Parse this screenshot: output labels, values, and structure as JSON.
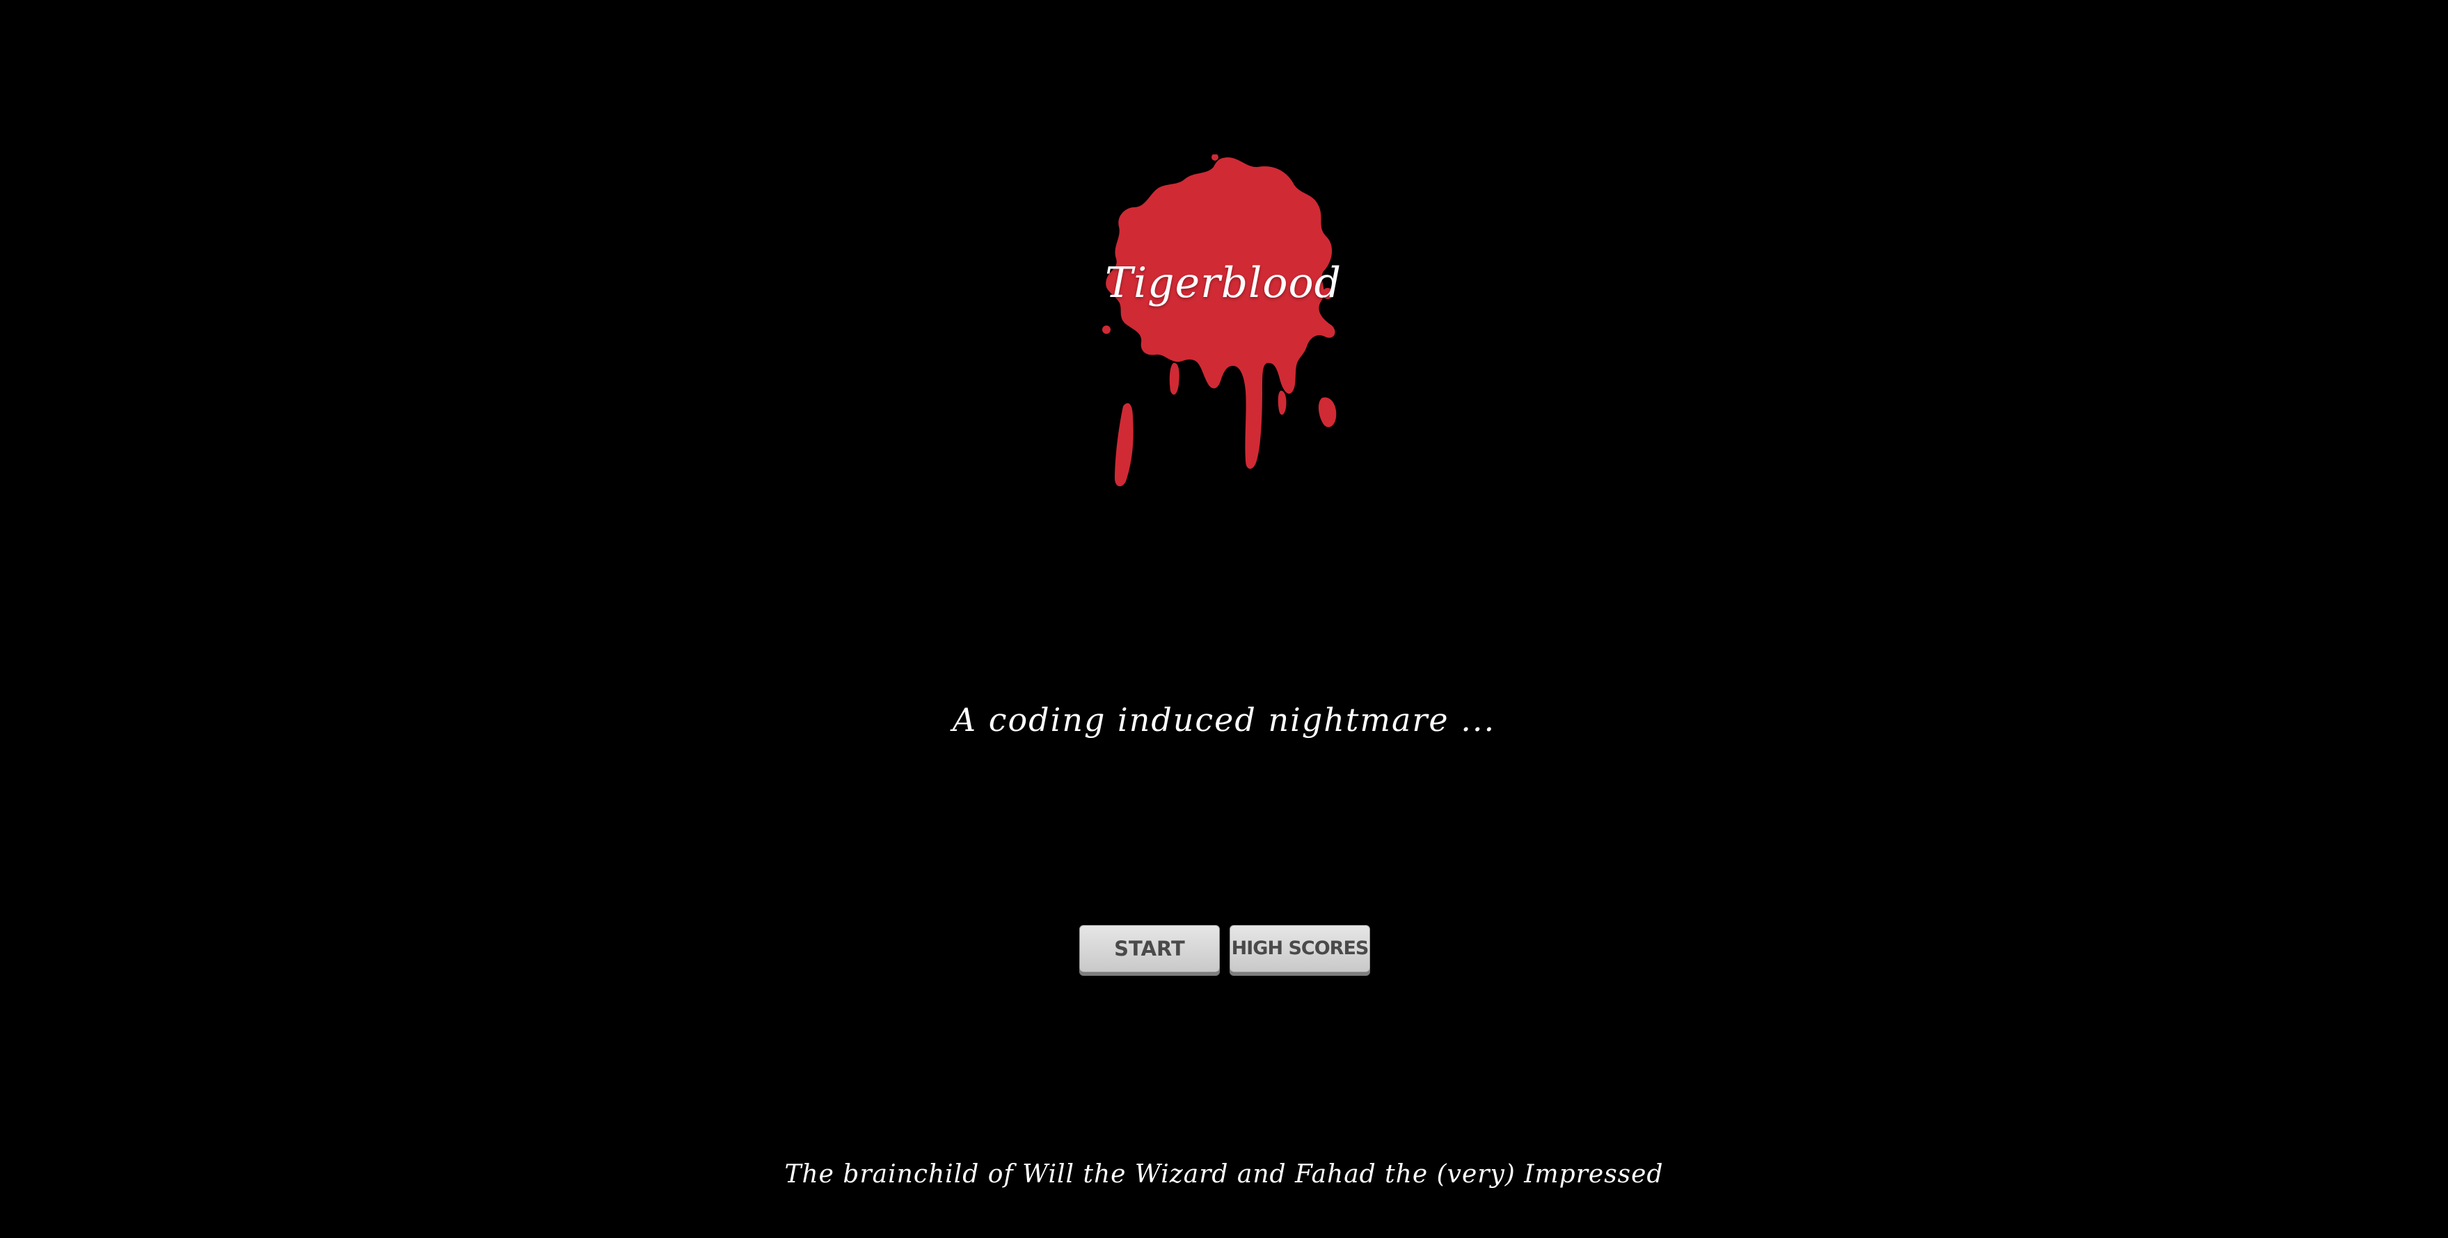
{
  "game": {
    "title": "Tigerblood",
    "tagline": "A coding induced nightmare ...",
    "credits": "The brainchild of Will the Wizard and Fahad the (very) Impressed"
  },
  "menu": {
    "start_label": "START",
    "high_scores_label": "HIGH SCORES"
  },
  "colors": {
    "background": "#000000",
    "blood": "#d02a35",
    "vignette": "#b3222c",
    "button": "#d6d6d6",
    "button_text": "#4a4a4a",
    "text": "#ffffff"
  },
  "icons": {
    "logo": "blood-splatter-icon"
  }
}
